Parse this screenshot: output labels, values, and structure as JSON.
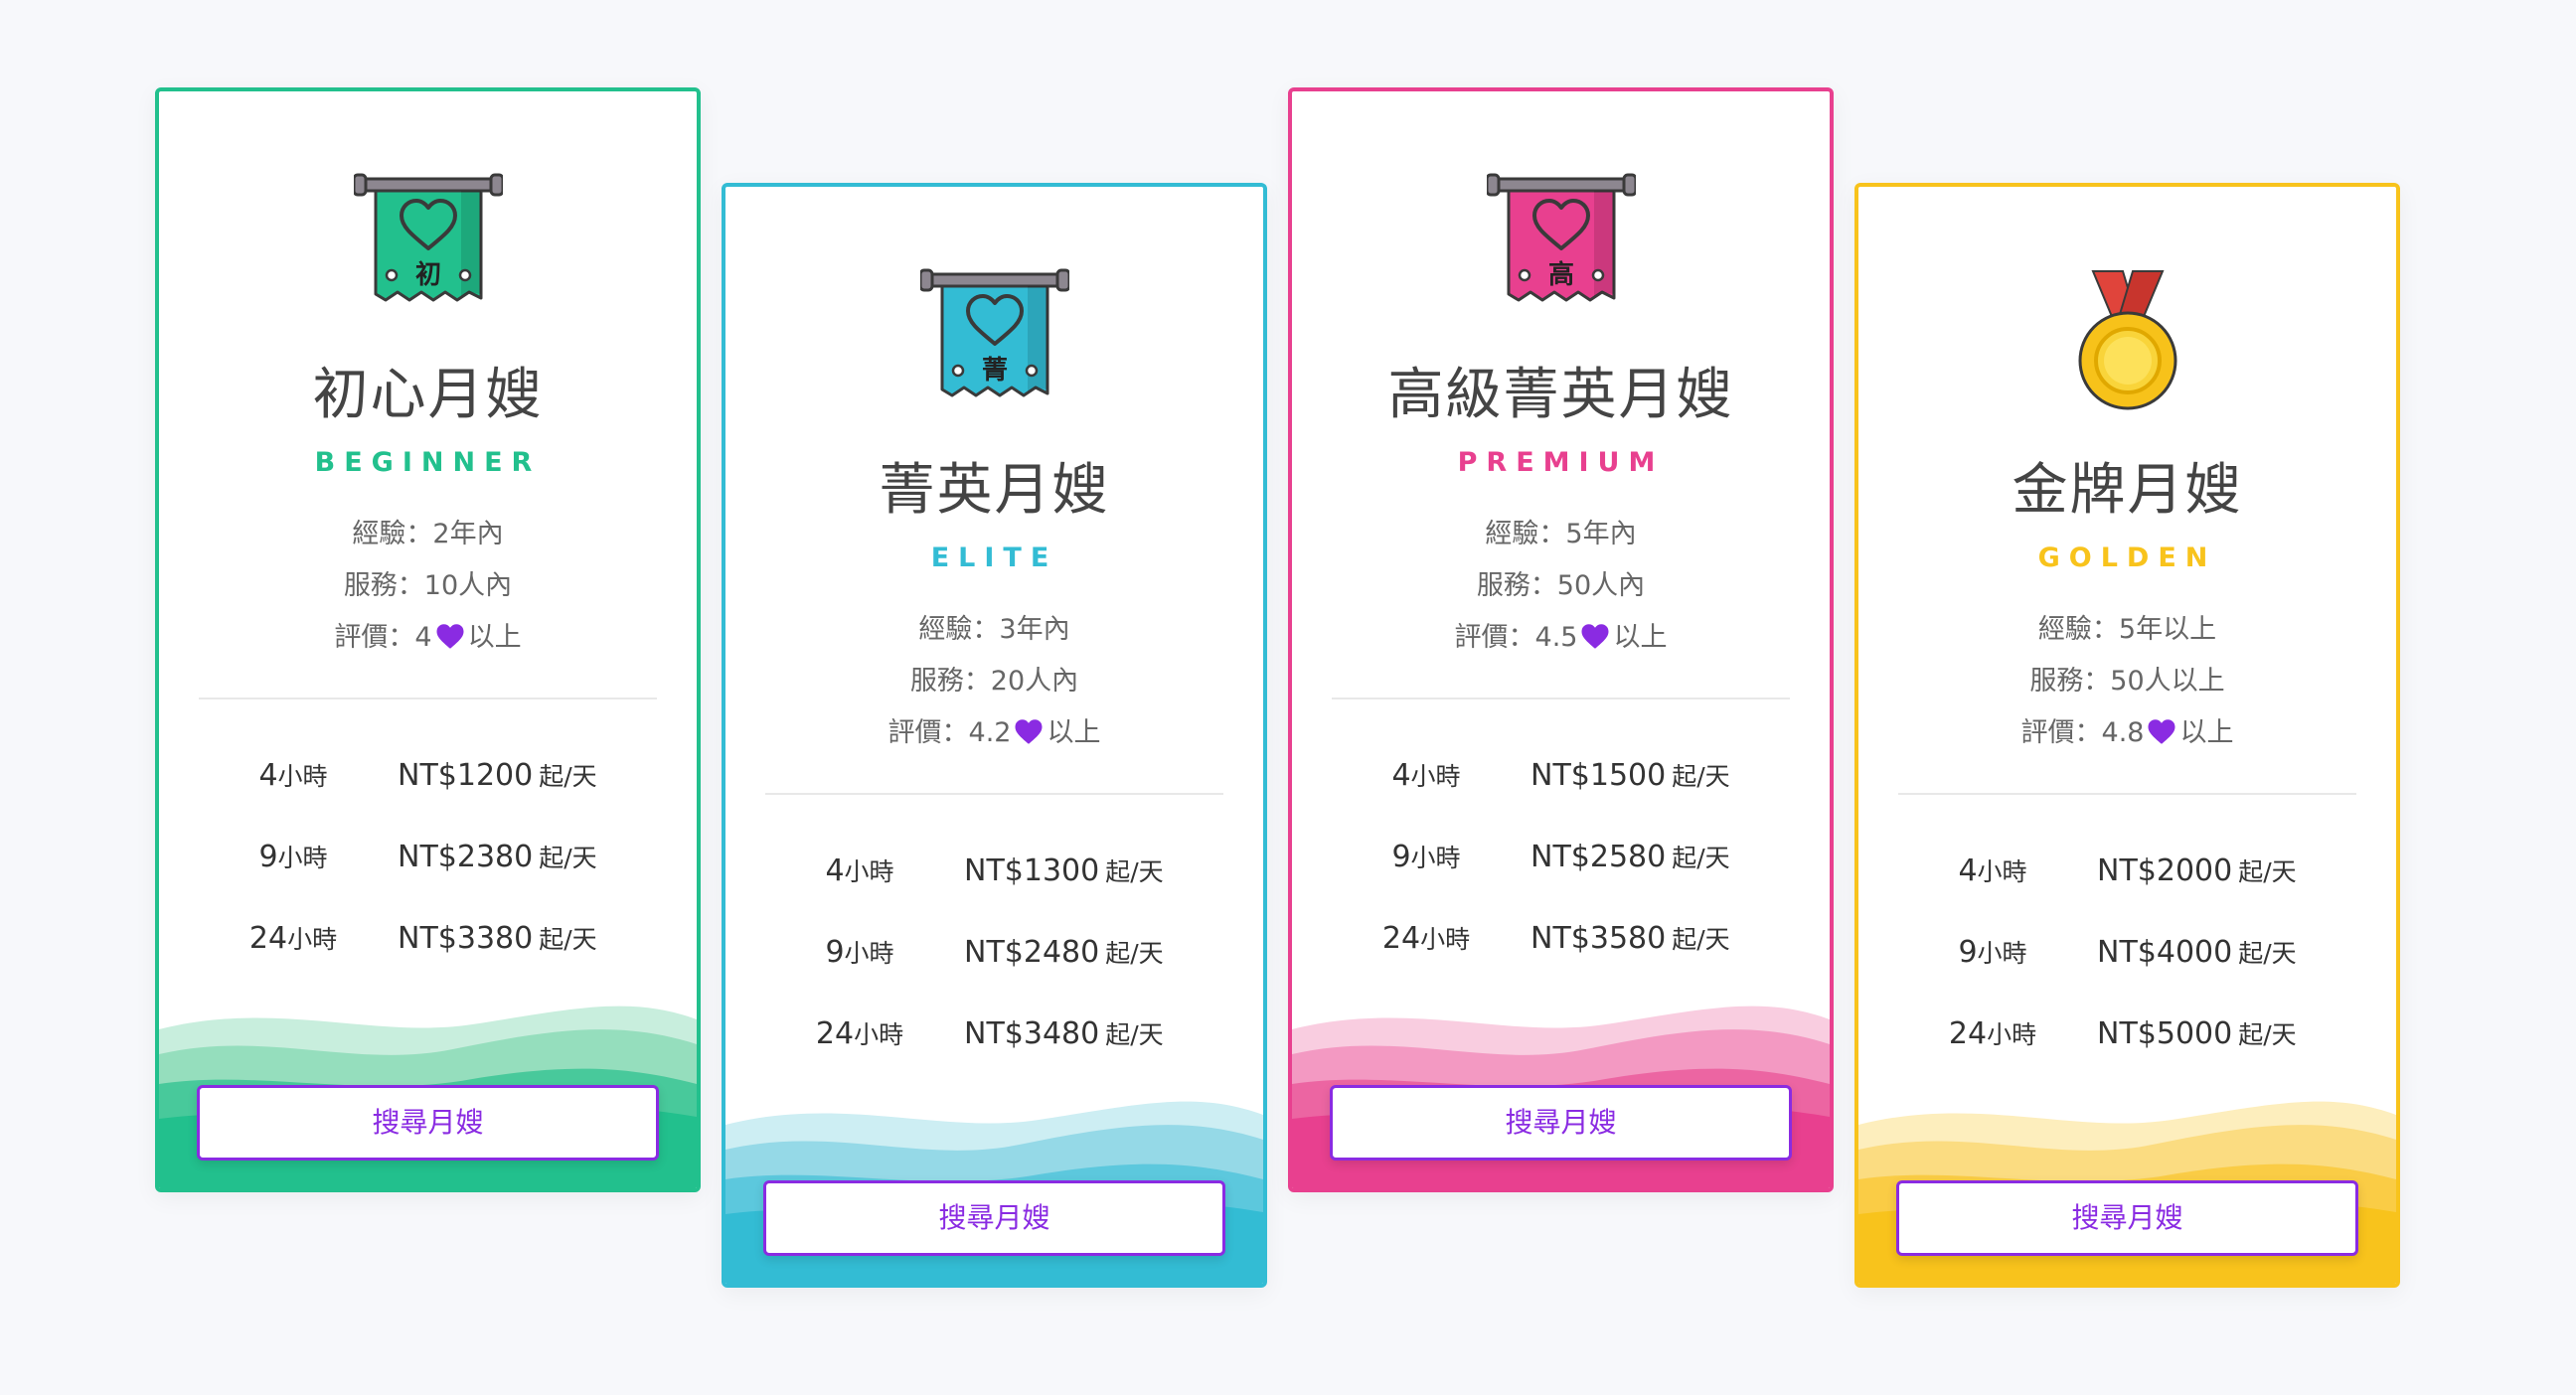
{
  "cards": [
    {
      "name": "初心月嫂",
      "eng": "BEGINNER",
      "badge_char": "初",
      "accent": "#22c08d",
      "experience": "經驗：2年內",
      "service": "服務：10人內",
      "rating_prefix": "評價：4",
      "rating_suffix": "以上",
      "prices": [
        {
          "hours": "4",
          "unit": "小時",
          "price": "NT$1200",
          "per": "起/天"
        },
        {
          "hours": "9",
          "unit": "小時",
          "price": "NT$2380",
          "per": "起/天"
        },
        {
          "hours": "24",
          "unit": "小時",
          "price": "NT$3380",
          "per": "起/天"
        }
      ],
      "button": "搜尋月嫂",
      "icon": "banner-heart-icon"
    },
    {
      "name": "菁英月嫂",
      "eng": "ELITE",
      "badge_char": "菁",
      "accent": "#33bcd4",
      "experience": "經驗：3年內",
      "service": "服務：20人內",
      "rating_prefix": "評價：4.2",
      "rating_suffix": "以上",
      "prices": [
        {
          "hours": "4",
          "unit": "小時",
          "price": "NT$1300",
          "per": "起/天"
        },
        {
          "hours": "9",
          "unit": "小時",
          "price": "NT$2480",
          "per": "起/天"
        },
        {
          "hours": "24",
          "unit": "小時",
          "price": "NT$3480",
          "per": "起/天"
        }
      ],
      "button": "搜尋月嫂",
      "icon": "banner-heart-icon"
    },
    {
      "name": "高級菁英月嫂",
      "eng": "PREMIUM",
      "badge_char": "高",
      "accent": "#e8408f",
      "experience": "經驗：5年內",
      "service": "服務：50人內",
      "rating_prefix": "評價：4.5",
      "rating_suffix": "以上",
      "prices": [
        {
          "hours": "4",
          "unit": "小時",
          "price": "NT$1500",
          "per": "起/天"
        },
        {
          "hours": "9",
          "unit": "小時",
          "price": "NT$2580",
          "per": "起/天"
        },
        {
          "hours": "24",
          "unit": "小時",
          "price": "NT$3580",
          "per": "起/天"
        }
      ],
      "button": "搜尋月嫂",
      "icon": "banner-heart-icon"
    },
    {
      "name": "金牌月嫂",
      "eng": "GOLDEN",
      "badge_char": "",
      "accent": "#f8c31c",
      "experience": "經驗：5年以上",
      "service": "服務：50人以上",
      "rating_prefix": "評價：4.8",
      "rating_suffix": "以上",
      "prices": [
        {
          "hours": "4",
          "unit": "小時",
          "price": "NT$2000",
          "per": "起/天"
        },
        {
          "hours": "9",
          "unit": "小時",
          "price": "NT$4000",
          "per": "起/天"
        },
        {
          "hours": "24",
          "unit": "小時",
          "price": "NT$5000",
          "per": "起/天"
        }
      ],
      "button": "搜尋月嫂",
      "icon": "gold-medal-icon"
    }
  ],
  "colors": {
    "heart": "#8a2be2",
    "button_text": "#8a2be2",
    "background": "#f7f8fb"
  }
}
